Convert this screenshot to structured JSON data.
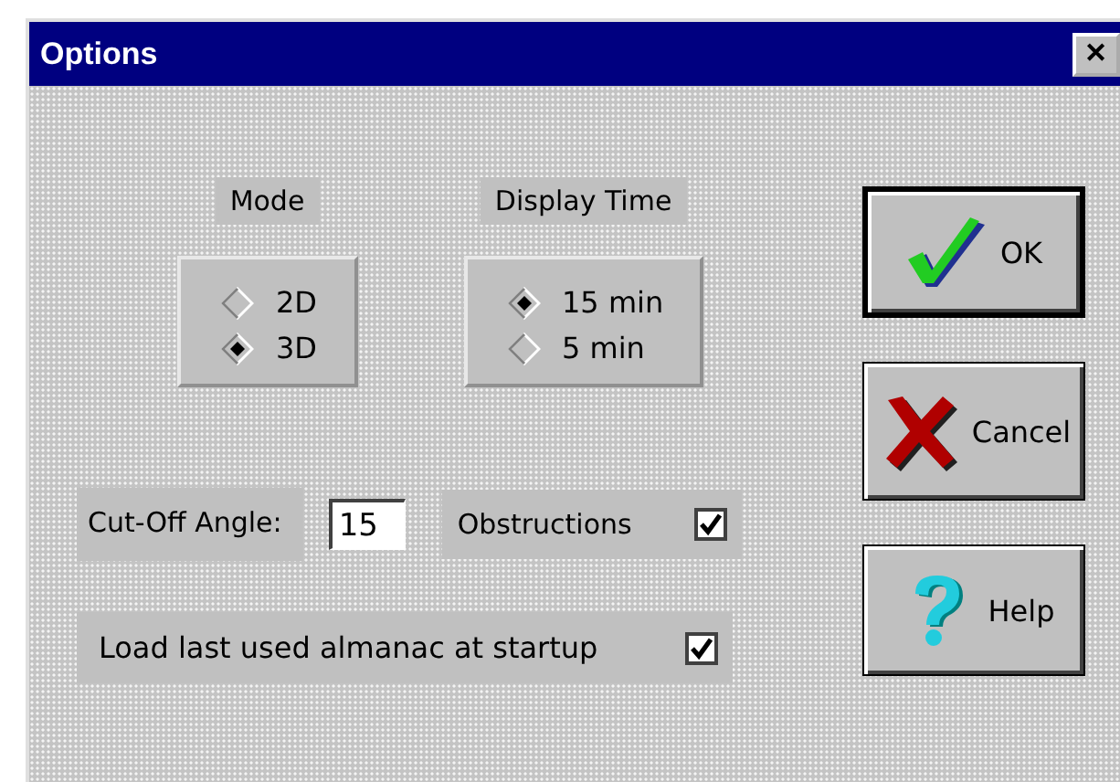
{
  "window": {
    "title": "Options",
    "close": "✕"
  },
  "groups": [
    {
      "label": "Mode",
      "options": [
        {
          "label": "2D",
          "selected": false
        },
        {
          "label": "3D",
          "selected": true
        }
      ]
    },
    {
      "label": "Display Time",
      "options": [
        {
          "label": "15 min",
          "selected": true
        },
        {
          "label": "5 min",
          "selected": false
        }
      ]
    }
  ],
  "cutoff": {
    "label": "Cut-Off Angle:",
    "value": "15"
  },
  "obstructions": {
    "label": "Obstructions",
    "checked": true
  },
  "load_last": {
    "label": "Load last used almanac at startup",
    "checked": true
  },
  "buttons": [
    {
      "kind": "ok",
      "label": "OK",
      "default": true
    },
    {
      "kind": "cancel",
      "label": "Cancel",
      "default": false
    },
    {
      "kind": "help",
      "label": "Help",
      "default": false
    }
  ]
}
